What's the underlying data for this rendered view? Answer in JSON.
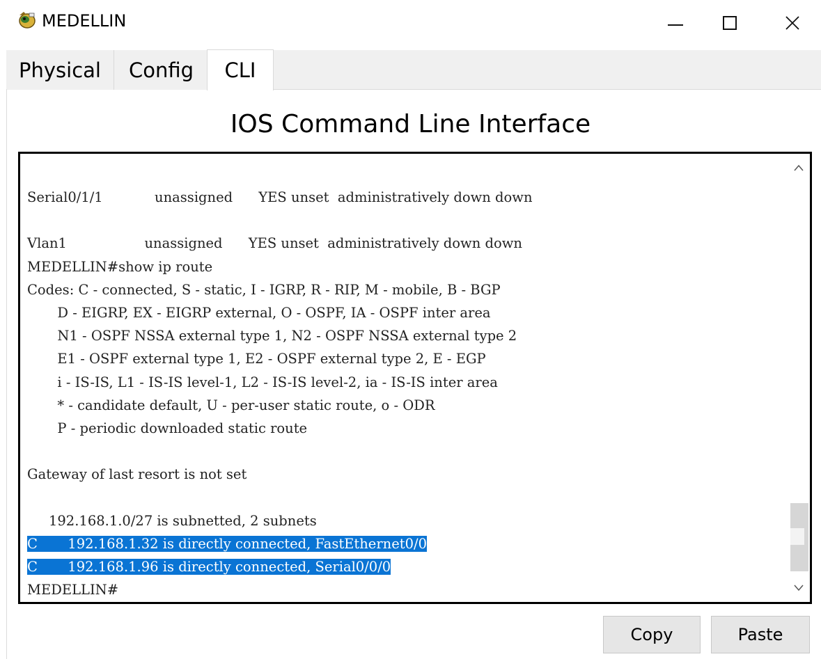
{
  "window": {
    "title": "MEDELLIN",
    "icon": "router-device-icon",
    "controls": {
      "minimize": "minimize-icon",
      "maximize": "maximize-icon",
      "close": "X"
    }
  },
  "tabs": [
    {
      "label": "Physical",
      "active": false
    },
    {
      "label": "Config",
      "active": false
    },
    {
      "label": "CLI",
      "active": true
    }
  ],
  "heading": "IOS Command Line Interface",
  "terminal": {
    "lines": [
      {
        "text": "Serial0/1/1            unassigned      YES unset  administratively down down",
        "selected": false
      },
      {
        "text": "",
        "selected": false
      },
      {
        "text": "Vlan1                  unassigned      YES unset  administratively down down",
        "selected": false
      },
      {
        "text": "MEDELLIN#show ip route",
        "selected": false
      },
      {
        "text": "Codes: C - connected, S - static, I - IGRP, R - RIP, M - mobile, B - BGP",
        "selected": false
      },
      {
        "text": "       D - EIGRP, EX - EIGRP external, O - OSPF, IA - OSPF inter area",
        "selected": false
      },
      {
        "text": "       N1 - OSPF NSSA external type 1, N2 - OSPF NSSA external type 2",
        "selected": false
      },
      {
        "text": "       E1 - OSPF external type 1, E2 - OSPF external type 2, E - EGP",
        "selected": false
      },
      {
        "text": "       i - IS-IS, L1 - IS-IS level-1, L2 - IS-IS level-2, ia - IS-IS inter area",
        "selected": false
      },
      {
        "text": "       * - candidate default, U - per-user static route, o - ODR",
        "selected": false
      },
      {
        "text": "       P - periodic downloaded static route",
        "selected": false
      },
      {
        "text": "",
        "selected": false
      },
      {
        "text": "Gateway of last resort is not set",
        "selected": false
      },
      {
        "text": "",
        "selected": false
      },
      {
        "text": "     192.168.1.0/27 is subnetted, 2 subnets",
        "selected": false
      },
      {
        "text": "C       192.168.1.32 is directly connected, FastEthernet0/0",
        "selected": true
      },
      {
        "text": "C       192.168.1.96 is directly connected, Serial0/0/0",
        "selected": true
      },
      {
        "text": "MEDELLIN#",
        "selected": false
      }
    ],
    "selection_color": "#0a74d4",
    "scroll_up_glyph": "^",
    "scroll_down_glyph": "v"
  },
  "buttons": {
    "copy": "Copy",
    "paste": "Paste"
  }
}
